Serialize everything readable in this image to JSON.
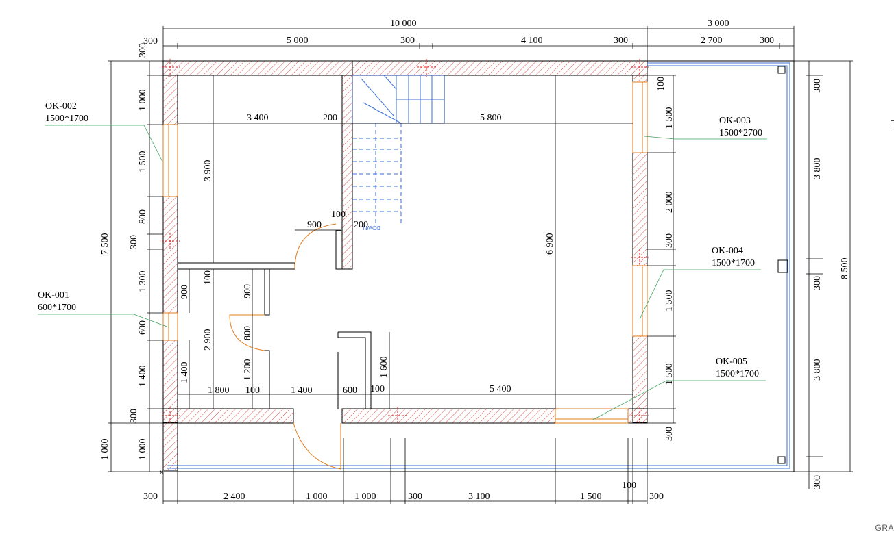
{
  "drawing": {
    "corner_tag": "GRA",
    "top_dims": {
      "overall_left": "10 000",
      "overall_right": "3 000",
      "segments": [
        "300",
        "5 000",
        "300",
        "4 100",
        "300",
        "2 700",
        "300"
      ]
    },
    "bottom_dims": [
      "300",
      "2 400",
      "1 000",
      "1 000",
      "300",
      "3 100",
      "1 500",
      "100",
      "300"
    ],
    "left_dims": {
      "overall": "7 500",
      "overall_lower": "1 000",
      "segments": [
        "300",
        "1 000",
        "1 500",
        "800",
        "300",
        "1 300",
        "600",
        "1 400",
        "300",
        "1 000"
      ]
    },
    "right_outer_dims": {
      "overall": "8 500",
      "segments": [
        "300",
        "3 800",
        "300",
        "3 800",
        "300"
      ]
    },
    "right_inner_dims": [
      "100",
      "1 500",
      "2 000",
      "300",
      "1 500",
      "1 500",
      "300"
    ],
    "interior_dims": [
      "3 400",
      "200",
      "5 800",
      "3 900",
      "6 900",
      "900",
      "100",
      "200",
      "100",
      "900",
      "900",
      "2 900",
      "800",
      "1 200",
      "1 400",
      "1 600",
      "1 800",
      "100",
      "1 400",
      "600",
      "100",
      "5 400"
    ],
    "windows": [
      {
        "id": "OK-002",
        "size": "1500*1700"
      },
      {
        "id": "OK-003",
        "size": "1500*2700"
      },
      {
        "id": "OK-004",
        "size": "1500*1700"
      },
      {
        "id": "OK-001",
        "size": "600*1700"
      },
      {
        "id": "OK-005",
        "size": "1500*1700"
      }
    ],
    "stair_label": "DOWN",
    "colors": {
      "wall_outline": "#000000",
      "hatch": "#d9534f",
      "leader": "#3aa35c",
      "door": "#e07b1a",
      "stair": "#3a6fd8",
      "axis": "#e02020"
    }
  }
}
